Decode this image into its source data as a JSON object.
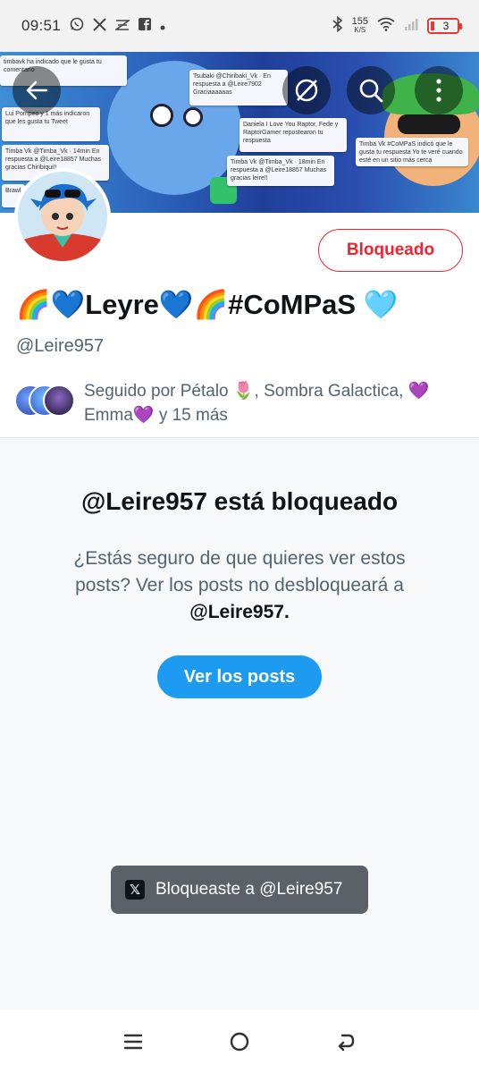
{
  "status_bar": {
    "time": "09:51",
    "speed_value": "155",
    "speed_unit": "K/S",
    "battery": "3",
    "left_icons": [
      "whatsapp-icon",
      "x-icon",
      "signal-app-icon",
      "facebook-icon",
      "dot-icon"
    ],
    "right_icons": [
      "bluetooth-icon",
      "wifi-icon",
      "cell-signal-icon",
      "battery-icon"
    ],
    "battery_color": "#e53935"
  },
  "header": {
    "back_icon": "arrow-left-icon",
    "grok_icon": "slash-circle-icon",
    "search_icon": "search-icon",
    "more_icon": "more-vertical-icon"
  },
  "banner": {
    "cards": [
      {
        "text": "timbavk ha indicado que le gusta tu comentario"
      },
      {
        "text": "Tsubaki @Chiribaki_Vk · En respuesta a @Leire7902 Graciaaaaaas"
      },
      {
        "text": "Lui Pompeo y 1 más indicaron que les gusta tu Tweet"
      },
      {
        "text": "Timba Vk @Timba_Vk · 14min En respuesta a @Leire18857 Muchas gracias Chiribiqui!!"
      },
      {
        "text": "Daniela I Love You Raptor, Fede y RaptorGamer repostearon tu respuesta"
      },
      {
        "text": "Timba Vk @Timba_Vk · 18min En respuesta a @Leire18857 Muchas gracias leire!!"
      },
      {
        "text": "Timba Vk #CoMPaS indicó que le gusta tu respuesta Yo te veré cuando esté en un sitio más cerca"
      },
      {
        "text": "Brawl"
      }
    ]
  },
  "profile": {
    "blocked_label": "Bloqueado",
    "name": "🌈💙Leyre💙🌈#CoMPaS 🩵",
    "handle": "@Leire957",
    "followed_by": "Seguido por Pétalo 🌷, Sombra Galactica, 💜 Emma💜 y 15 más"
  },
  "blocked": {
    "title": "@Leire957 está bloqueado",
    "description_pre": "¿Estás seguro de que quieres ver estos posts? Ver los posts no desbloqueará a ",
    "description_handle": "@Leire957",
    "description_post": ".",
    "view_posts_label": "Ver los posts"
  },
  "toast": {
    "logo": "𝕏",
    "text": "Bloqueaste a @Leire957"
  },
  "nav": {
    "menu_icon": "recent-apps-icon",
    "home_icon": "home-circle-icon",
    "back_icon": "back-icon"
  },
  "colors": {
    "accent": "#1d9bf0",
    "blocked_red": "#f4212e",
    "muted": "#536471"
  }
}
